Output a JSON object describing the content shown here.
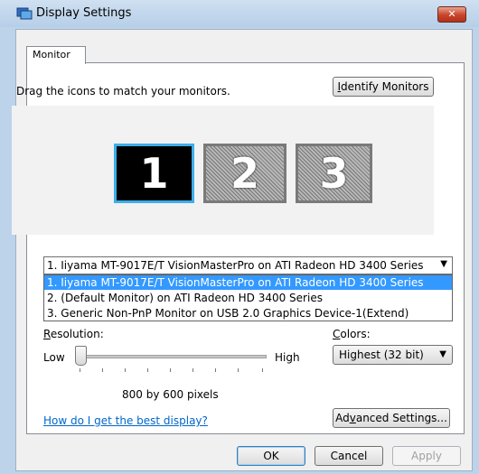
{
  "window": {
    "title": "Display Settings",
    "close_glyph": "✕"
  },
  "tabs": [
    {
      "label": "Monitor"
    }
  ],
  "monitor_tab": {
    "instruction": "Drag the icons to match your monitors.",
    "identify_button": "Identify Monitors",
    "monitors": [
      {
        "number": "1"
      },
      {
        "number": "2"
      },
      {
        "number": "3"
      }
    ],
    "selected_monitor": "1. Iiyama MT-9017E/T VisionMasterPro on ATI Radeon HD 3400 Series",
    "monitor_options": [
      "1. Iiyama MT-9017E/T VisionMasterPro on ATI Radeon HD 3400 Series",
      "2. (Default Monitor) on ATI Radeon HD 3400 Series",
      "3. Generic Non-PnP Monitor on USB 2.0 Graphics Device-1(Extend)"
    ],
    "resolution": {
      "label_accel": "R",
      "label_rest": "esolution:",
      "low": "Low",
      "high": "High",
      "value_text": "800 by 600 pixels",
      "slider_fraction": 0.0
    },
    "colors": {
      "label_accel": "C",
      "label_rest": "olors:",
      "value": "Highest (32 bit)"
    },
    "help_link": "How do I get the best display?",
    "advanced_button_pre": "Ad",
    "advanced_button_accel": "v",
    "advanced_button_post": "anced Settings..."
  },
  "footer": {
    "ok": "OK",
    "cancel": "Cancel",
    "apply": "Apply"
  },
  "icons": {
    "app": "display-settings-icon",
    "dropdown": "chevron-down-icon"
  },
  "colors": {
    "selection": "#3399ff",
    "link": "#0066cc",
    "selected_monitor_border": "#3daee9"
  }
}
